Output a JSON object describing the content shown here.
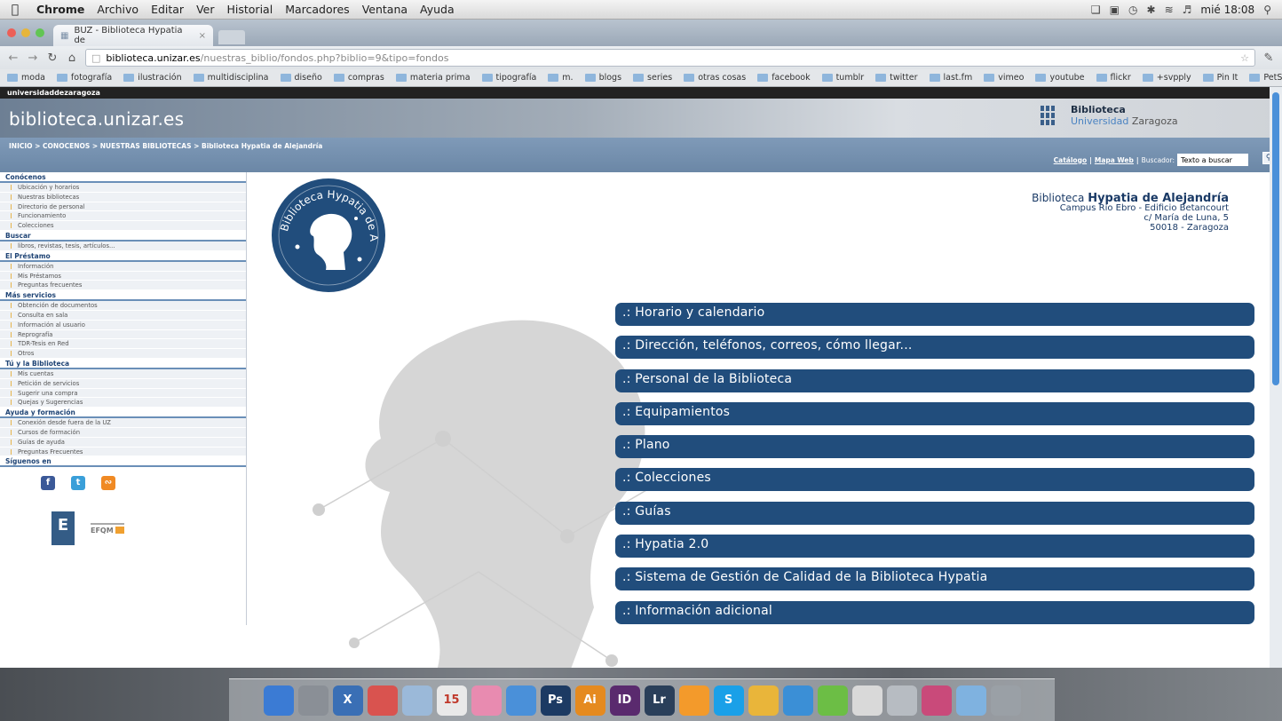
{
  "os_menu": {
    "app": "Chrome",
    "items": [
      "Archivo",
      "Editar",
      "Ver",
      "Historial",
      "Marcadores",
      "Ventana",
      "Ayuda"
    ],
    "clock": "mié 18:08"
  },
  "browser": {
    "tab_title": "BUZ - Biblioteca Hypatia de",
    "url_host": "biblioteca.unizar.es",
    "url_path": "/nuestras_biblio/fondos.php?biblio=9&tipo=fondos",
    "bookmarks": [
      "moda",
      "fotografía",
      "ilustración",
      "multidisciplina",
      "diseño",
      "compras",
      "materia prima",
      "tipografía",
      "m.",
      "blogs",
      "series",
      "otras cosas",
      "facebook",
      "tumblr",
      "twitter",
      "last.fm",
      "vimeo",
      "youtube",
      "flickr",
      "+svpply",
      "Pin It",
      "PetSociety's"
    ]
  },
  "site": {
    "top_bar": "universidaddezaragoza",
    "title": "biblioteca.unizar.es",
    "logo_line1": "Biblioteca",
    "logo_line2_a": "Universidad",
    "logo_line2_b": "Zaragoza",
    "breadcrumb": "INICIO > CONOCENOS > NUESTRAS BIBLIOTECAS > Biblioteca Hypatia de Alejandría",
    "catalogo": "Catálogo",
    "mapa": "Mapa Web",
    "buscador": "Buscador:",
    "search_value": "Texto a buscar"
  },
  "sidebar": {
    "sections": [
      {
        "title": "Conócenos",
        "items": [
          "Ubicación y horarios",
          "Nuestras bibliotecas",
          "Directorio de personal",
          "Funcionamiento",
          "Colecciones"
        ]
      },
      {
        "title": "Buscar",
        "items": [
          "libros, revistas, tesis, artículos..."
        ]
      },
      {
        "title": "El Préstamo",
        "items": [
          "Información",
          "Mis Préstamos",
          "Preguntas frecuentes"
        ]
      },
      {
        "title": "Más servicios",
        "items": [
          "Obtención de documentos",
          "Consulta en sala",
          "Información al usuario",
          "Reprografía",
          "TDR-Tesis en Red",
          "Otros"
        ]
      },
      {
        "title": "Tú y la Biblioteca",
        "items": [
          "Mis cuentas",
          "Petición de servicios",
          "Sugerir una compra",
          "Quejas y Sugerencias"
        ]
      },
      {
        "title": "Ayuda y formación",
        "items": [
          "Conexión desde fuera de la UZ",
          "Cursos de formación",
          "Guías de ayuda",
          "Preguntas Frecuentes"
        ]
      },
      {
        "title": "Síguenos en",
        "items": []
      }
    ],
    "efqm": "EFQM"
  },
  "library": {
    "seal_text": "Biblioteca Hypatia de Alejandría",
    "name_prefix": "Biblioteca",
    "name_bold": "Hypatia de Alejandría",
    "address": [
      "Campus Río Ebro - Edificio Betancourt",
      "c/ María de Luna, 5",
      "50018 - Zaragoza"
    ]
  },
  "menu": [
    ".: Horario y calendario",
    ".: Dirección, teléfonos, correos, cómo llegar...",
    ".: Personal de la Biblioteca",
    ".: Equipamientos",
    ".: Plano",
    ".: Colecciones",
    ".: Guías",
    ".: Hypatia 2.0",
    ".: Sistema de Gestión de Calidad de la Biblioteca Hypatia",
    ".: Información adicional"
  ],
  "dock": [
    {
      "label": "",
      "color": "#3b7bd4",
      "icon": "finder-icon"
    },
    {
      "label": "",
      "color": "#8a8f96",
      "icon": "preview-icon"
    },
    {
      "label": "X",
      "color": "#3a6fb5",
      "icon": "mission-control-icon"
    },
    {
      "label": "",
      "color": "#d9534f",
      "icon": "photo-booth-icon"
    },
    {
      "label": "",
      "color": "#9bb9d9",
      "icon": "image-icon"
    },
    {
      "label": "15",
      "color": "#e9e9e9",
      "icon": "calendar-icon"
    },
    {
      "label": "",
      "color": "#e88bb0",
      "icon": "photos-icon"
    },
    {
      "label": "",
      "color": "#4a90d9",
      "icon": "safari-icon"
    },
    {
      "label": "Ps",
      "color": "#1c3a63",
      "icon": "photoshop-icon"
    },
    {
      "label": "Ai",
      "color": "#e58a1f",
      "icon": "illustrator-icon"
    },
    {
      "label": "ID",
      "color": "#5a2a6e",
      "icon": "indesign-icon"
    },
    {
      "label": "Lr",
      "color": "#2a3f5a",
      "icon": "lightroom-icon"
    },
    {
      "label": "",
      "color": "#f39a2b",
      "icon": "vlc-icon"
    },
    {
      "label": "S",
      "color": "#1aa0e8",
      "icon": "skype-icon"
    },
    {
      "label": "",
      "color": "#e9b53a",
      "icon": "chrome-icon"
    },
    {
      "label": "",
      "color": "#3b8fd6",
      "icon": "itunes-icon"
    },
    {
      "label": "",
      "color": "#6cbe45",
      "icon": "spotify-icon"
    },
    {
      "label": "",
      "color": "#d9d9d9",
      "icon": "acrobat-icon"
    },
    {
      "label": "",
      "color": "#b7bcc2",
      "icon": "documents-icon"
    },
    {
      "label": "",
      "color": "#c94a7a",
      "icon": "downloads-icon"
    },
    {
      "label": "",
      "color": "#7fb2e0",
      "icon": "applications-icon"
    },
    {
      "label": "",
      "color": "#9aa0a6",
      "icon": "trash-icon"
    }
  ]
}
